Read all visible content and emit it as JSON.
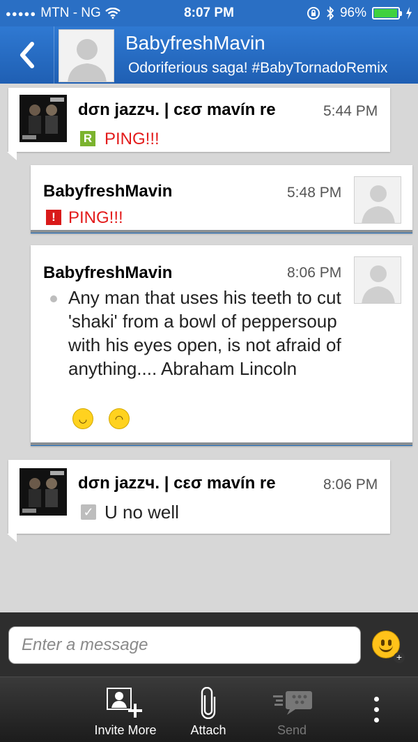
{
  "status_bar": {
    "carrier": "MTN - NG",
    "time": "8:07 PM",
    "battery_percent": "96%",
    "battery_level": 0.96,
    "icons": [
      "signal-dots-icon",
      "wifi-icon",
      "rotation-lock-icon",
      "bluetooth-icon",
      "battery-icon",
      "charging-icon"
    ]
  },
  "header": {
    "back_icon": "chevron-left-icon",
    "contact_name": "BabyfreshMavin",
    "contact_status": "Odoriferious saga! #BabyTornadoRemix"
  },
  "messages": [
    {
      "direction": "incoming",
      "sender": "dσn jazzч. | cεσ mavín re",
      "time": "5:44 PM",
      "status_badge": "R",
      "status_color": "#7bb32e",
      "text": "PING!!!"
    },
    {
      "direction": "outgoing",
      "sender": "BabyfreshMavin",
      "time": "5:48 PM",
      "status_badge": "!",
      "status_color": "#d91a1a",
      "text": "PING!!!"
    },
    {
      "direction": "outgoing",
      "sender": "BabyfreshMavin",
      "time": "8:06 PM",
      "text": "Any man that uses his teeth to cut 'shaki' from a bowl of peppersoup with his eyes open, is not afraid of anything.... Abraham Lincoln",
      "emojis": [
        "grinning-emoji",
        "laughing-emoji"
      ]
    },
    {
      "direction": "incoming",
      "sender": "dσn jazzч. | cεσ mavín re",
      "time": "8:06 PM",
      "status_badge": "✓",
      "text": "U no well"
    }
  ],
  "composer": {
    "placeholder": "Enter a message",
    "emoji_button": "emoji-add-icon"
  },
  "toolbar": {
    "invite_label": "Invite More",
    "attach_label": "Attach",
    "send_label": "Send",
    "more_icon": "more-vertical-icon"
  },
  "colors": {
    "header_blue": "#2a6fc4",
    "ping_red": "#e31b1b",
    "outgoing_accent": "#1e6fc0"
  }
}
